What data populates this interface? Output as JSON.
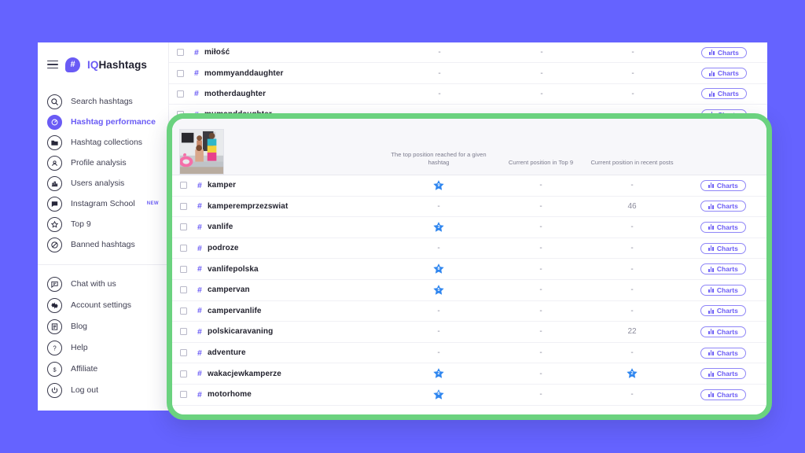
{
  "theme": {
    "background": "#6563ff",
    "accent": "#6a5bf5",
    "highlight_border": "#6bd27f",
    "star_blue": "#2f86ef"
  },
  "sidebar": {
    "brand": {
      "iq": "IQ",
      "hashtags": "Hashtags",
      "logo_glyph": "#"
    },
    "items": [
      {
        "label": "Search hashtags",
        "icon": "search-icon",
        "active": false
      },
      {
        "label": "Hashtag performance",
        "icon": "performance-icon",
        "active": true
      },
      {
        "label": "Hashtag collections",
        "icon": "collections-icon",
        "active": false
      },
      {
        "label": "Profile analysis",
        "icon": "profile-icon",
        "active": false
      },
      {
        "label": "Users analysis",
        "icon": "users-analysis-icon",
        "active": false
      },
      {
        "label": "Instagram School",
        "icon": "school-icon",
        "active": false,
        "badge": "NEW"
      },
      {
        "label": "Top 9",
        "icon": "star-outline-icon",
        "active": false
      },
      {
        "label": "Banned hashtags",
        "icon": "banned-icon",
        "active": false
      }
    ],
    "bottom_items": [
      {
        "label": "Chat with us",
        "icon": "chat-icon"
      },
      {
        "label": "Account settings",
        "icon": "gear-icon"
      },
      {
        "label": "Blog",
        "icon": "blog-icon"
      },
      {
        "label": "Help",
        "icon": "help-icon"
      },
      {
        "label": "Affiliate",
        "icon": "dollar-icon"
      },
      {
        "label": "Log out",
        "icon": "power-icon"
      }
    ]
  },
  "table": {
    "columns": {
      "top_position": "The top position reached for a given hashtag",
      "current_top9": "Current position in Top 9",
      "current_recent": "Current position in recent posts",
      "action": ""
    },
    "charts_label": "Charts",
    "hash_glyph": "#",
    "dash": "-"
  },
  "background_rows": [
    {
      "name": "miłość",
      "top": "-",
      "top9": "-",
      "recent": "-"
    },
    {
      "name": "mommyanddaughter",
      "top": "-",
      "top9": "-",
      "recent": "-"
    },
    {
      "name": "motherdaughter",
      "top": "-",
      "top9": "-",
      "recent": "-"
    },
    {
      "name": "mumanddaughter",
      "top": "-",
      "top9": "-",
      "recent": "-"
    }
  ],
  "highlight_rows": [
    {
      "name": "kamper",
      "top_star": "9",
      "top": "",
      "top9": "-",
      "recent": "-"
    },
    {
      "name": "kamperemprzezswiat",
      "top_star": "",
      "top": "-",
      "top9": "-",
      "recent": "46"
    },
    {
      "name": "vanlife",
      "top_star": "3",
      "top": "",
      "top9": "-",
      "recent": "-"
    },
    {
      "name": "podroze",
      "top_star": "",
      "top": "-",
      "top9": "-",
      "recent": "-"
    },
    {
      "name": "vanlifepolska",
      "top_star": "8",
      "top": "",
      "top9": "-",
      "recent": "-"
    },
    {
      "name": "campervan",
      "top_star": "5",
      "top": "",
      "top9": "-",
      "recent": "-"
    },
    {
      "name": "campervanlife",
      "top_star": "",
      "top": "-",
      "top9": "-",
      "recent": "-"
    },
    {
      "name": "polskicaravaning",
      "top_star": "",
      "top": "-",
      "top9": "-",
      "recent": "22"
    },
    {
      "name": "adventure",
      "top_star": "",
      "top": "-",
      "top9": "-",
      "recent": "-"
    },
    {
      "name": "wakacjewkamperze",
      "top_star": "2",
      "top": "",
      "top9": "-",
      "recent_star": "2",
      "recent": ""
    },
    {
      "name": "motorhome",
      "top_star": "6",
      "top": "",
      "top9": "-",
      "recent": "-"
    }
  ],
  "thumbnail": {
    "alt": "family-in-front-of-camper-van-photo"
  }
}
